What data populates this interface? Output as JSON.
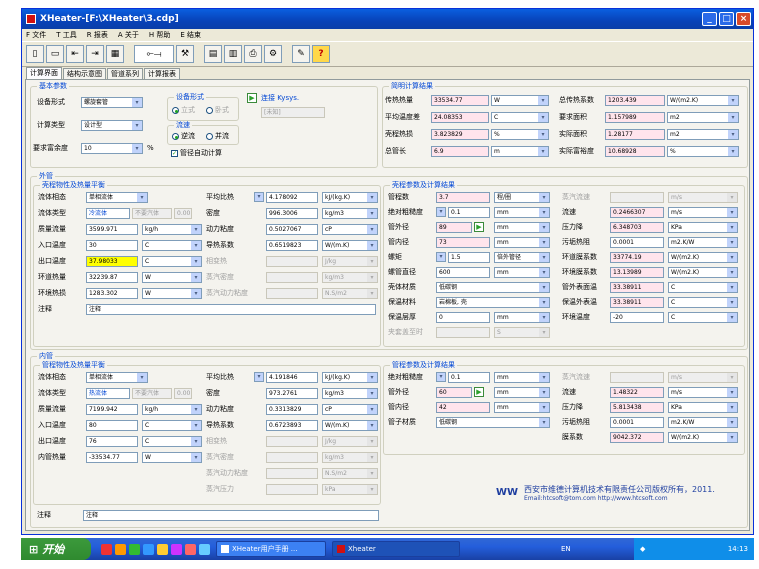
{
  "window": {
    "title": "XHeater-[F:\\XHeater\\3.cdp]"
  },
  "menu": [
    "F 文件",
    "T 工具",
    "R 报表",
    "A 关于",
    "H 帮助",
    "E 结束"
  ],
  "tabs": [
    "计算界面",
    "结构示意图",
    "管道系列",
    "计算报表"
  ],
  "basic": {
    "legend": "基本参数",
    "equip_label": "设备形式",
    "equip_value": "螺旋套管",
    "calc_label": "计算类型",
    "calc_value": "设计型",
    "margin_label": "要求富余度",
    "margin_value": "10",
    "margin_unit": "%",
    "struct_legend": "设备形式",
    "struct_opt1": "立式",
    "struct_opt2": "卧式",
    "flow_legend": "流速",
    "flow_opt1": "逆流",
    "flow_opt2": "并流",
    "auto_label": "管径自动计算",
    "link_label": "连接 Kysys.",
    "unknown_value": "[未知]"
  },
  "simple": {
    "legend": "简明计算结果",
    "rows": [
      {
        "l1": "传热热量",
        "v1": "33534.77",
        "u1": "W",
        "l2": "总传热系数",
        "v2": "1203.439",
        "u2": "W/(m2.K)"
      },
      {
        "l1": "平均温度差",
        "v1": "24.08353",
        "u1": "C",
        "l2": "要求面积",
        "v2": "1.157989",
        "u2": "m2"
      },
      {
        "l1": "壳程热损",
        "v1": "3.823829",
        "u1": "%",
        "l2": "实际面积",
        "v2": "1.28177",
        "u2": "m2"
      },
      {
        "l1": "总管长",
        "v1": "6.9",
        "u1": "m",
        "l2": "实际富裕度",
        "v2": "10.68928",
        "u2": "%"
      }
    ]
  },
  "outer": {
    "legend": "外管",
    "props_legend": "壳程物性及热量平衡",
    "left": [
      {
        "label": "流体相态",
        "value": "单相流体",
        "unit": ""
      },
      {
        "label": "流体类型",
        "value": "冷流体",
        "unit": ""
      },
      {
        "label": "质量流量",
        "value": "3599.971",
        "unit": "kg/h"
      },
      {
        "label": "入口温度",
        "value": "30",
        "unit": "C"
      },
      {
        "label": "出口温度",
        "value": "37.98033",
        "unit": "C"
      },
      {
        "label": "环道热量",
        "value": "32239.87",
        "unit": "W"
      },
      {
        "label": "环境热损",
        "value": "1283.302",
        "unit": "W"
      },
      {
        "label": "注释",
        "value": "注释",
        "unit": ""
      }
    ],
    "phase_hint": "不要汽体",
    "phase_num": "0.00",
    "right": [
      {
        "label": "平均比热",
        "value": "4.178092",
        "unit": "kJ/(kg.K)"
      },
      {
        "label": "密度",
        "value": "996.3006",
        "unit": "kg/m3"
      },
      {
        "label": "动力粘度",
        "value": "0.5027067",
        "unit": "cP"
      },
      {
        "label": "导热系数",
        "value": "0.6519823",
        "unit": "W/(m.K)"
      },
      {
        "label": "相变热",
        "value": "",
        "unit": "J/kg"
      },
      {
        "label": "蒸汽密度",
        "value": "",
        "unit": "kg/m3"
      },
      {
        "label": "蒸汽动力粘度",
        "value": "",
        "unit": "N.S/m2"
      }
    ],
    "struct_legend": "壳程参数及计算结果",
    "s_left": [
      {
        "label": "管程数",
        "value": "3.7",
        "unit": "程/圈"
      },
      {
        "label": "绝对粗糙度",
        "value": "0.1",
        "unit": "mm"
      },
      {
        "label": "管外径",
        "value": "89",
        "unit": "mm"
      },
      {
        "label": "管内径",
        "value": "73",
        "unit": "mm"
      },
      {
        "label": "螺矩",
        "value": "1.5",
        "unit": "倍外管径"
      },
      {
        "label": "螺管直径",
        "value": "600",
        "unit": "mm"
      },
      {
        "label": "壳体材质",
        "value": "低碳钢",
        "unit": ""
      },
      {
        "label": "保温材料",
        "value": "岩棉板, 壳",
        "unit": ""
      },
      {
        "label": "保温层厚",
        "value": "0",
        "unit": "mm"
      },
      {
        "label": "夹套盖至时",
        "value": "",
        "unit": "S"
      }
    ],
    "s_right": [
      {
        "label": "蒸汽流速",
        "value": "",
        "unit": "m/s"
      },
      {
        "label": "流速",
        "value": "0.2466307",
        "unit": "m/s"
      },
      {
        "label": "压力降",
        "value": "6.348703",
        "unit": "KPa"
      },
      {
        "label": "污垢热阻",
        "value": "0.0001",
        "unit": "m2.K/W"
      },
      {
        "label": "环道膜系数",
        "value": "33774.19",
        "unit": "W/(m2.K)"
      },
      {
        "label": "环境膜系数",
        "value": "13.13989",
        "unit": "W/(m2.K)"
      },
      {
        "label": "管外表面温",
        "value": "33.38911",
        "unit": "C"
      },
      {
        "label": "保温外表温",
        "value": "33.38911",
        "unit": "C"
      },
      {
        "label": "环境温度",
        "value": "-20",
        "unit": "C"
      }
    ]
  },
  "inner": {
    "legend": "内管",
    "props_legend": "管程物性及热量平衡",
    "left": [
      {
        "label": "流体相态",
        "value": "单相流体",
        "unit": ""
      },
      {
        "label": "流体类型",
        "value": "热流体",
        "unit": ""
      },
      {
        "label": "质量流量",
        "value": "7199.942",
        "unit": "kg/h"
      },
      {
        "label": "入口温度",
        "value": "80",
        "unit": "C"
      },
      {
        "label": "出口温度",
        "value": "76",
        "unit": "C"
      },
      {
        "label": "内管热量",
        "value": "-33534.77",
        "unit": "W"
      }
    ],
    "phase_hint": "不要汽体",
    "phase_num": "0.00",
    "right": [
      {
        "label": "平均比热",
        "value": "4.191846",
        "unit": "kJ/(kg.K)"
      },
      {
        "label": "密度",
        "value": "973.2761",
        "unit": "kg/m3"
      },
      {
        "label": "动力粘度",
        "value": "0.3313829",
        "unit": "cP"
      },
      {
        "label": "导热系数",
        "value": "0.6723893",
        "unit": "W/(m.K)"
      },
      {
        "label": "相变热",
        "value": "",
        "unit": "J/kg"
      },
      {
        "label": "蒸汽密度",
        "value": "",
        "unit": "kg/m3"
      },
      {
        "label": "蒸汽动力粘度",
        "value": "",
        "unit": "N.S/m2"
      },
      {
        "label": "蒸汽压力",
        "value": "",
        "unit": "kPa"
      }
    ],
    "comment_label": "注释",
    "comment_value": "注释",
    "struct_legend": "管程参数及计算结果",
    "s_left": [
      {
        "label": "绝对粗糙度",
        "value": "0.1",
        "unit": "mm"
      },
      {
        "label": "管外径",
        "value": "60",
        "unit": "mm"
      },
      {
        "label": "管内径",
        "value": "42",
        "unit": "mm"
      },
      {
        "label": "管子材质",
        "value": "低碳钢",
        "unit": ""
      }
    ],
    "s_right": [
      {
        "label": "蒸汽流速",
        "value": "",
        "unit": "m/s"
      },
      {
        "label": "流速",
        "value": "1.48322",
        "unit": "m/s"
      },
      {
        "label": "压力降",
        "value": "5.813438",
        "unit": "KPa"
      },
      {
        "label": "污垢热阻",
        "value": "0.0001",
        "unit": "m2.K/W"
      },
      {
        "label": "膜系数",
        "value": "9042.372",
        "unit": "W/(m2.K)"
      }
    ]
  },
  "logo": {
    "mark": "WW",
    "company": "西安市维德计算机技术有限责任公司版权所有，2011.",
    "contact": "Email:htcsoft@tom.com   http://www.htcsoft.com"
  },
  "taskbar": {
    "start": "开始",
    "task1": "XHeater用户手册 ...",
    "task2": "Xheater",
    "ime": "EN",
    "clock": "14:13"
  },
  "colors": {
    "titlebar": "#0842b8",
    "legend": "#0046d5",
    "pink": "#ffe4ec",
    "highlight": "#ffff00",
    "taskbar": "#245edb"
  }
}
